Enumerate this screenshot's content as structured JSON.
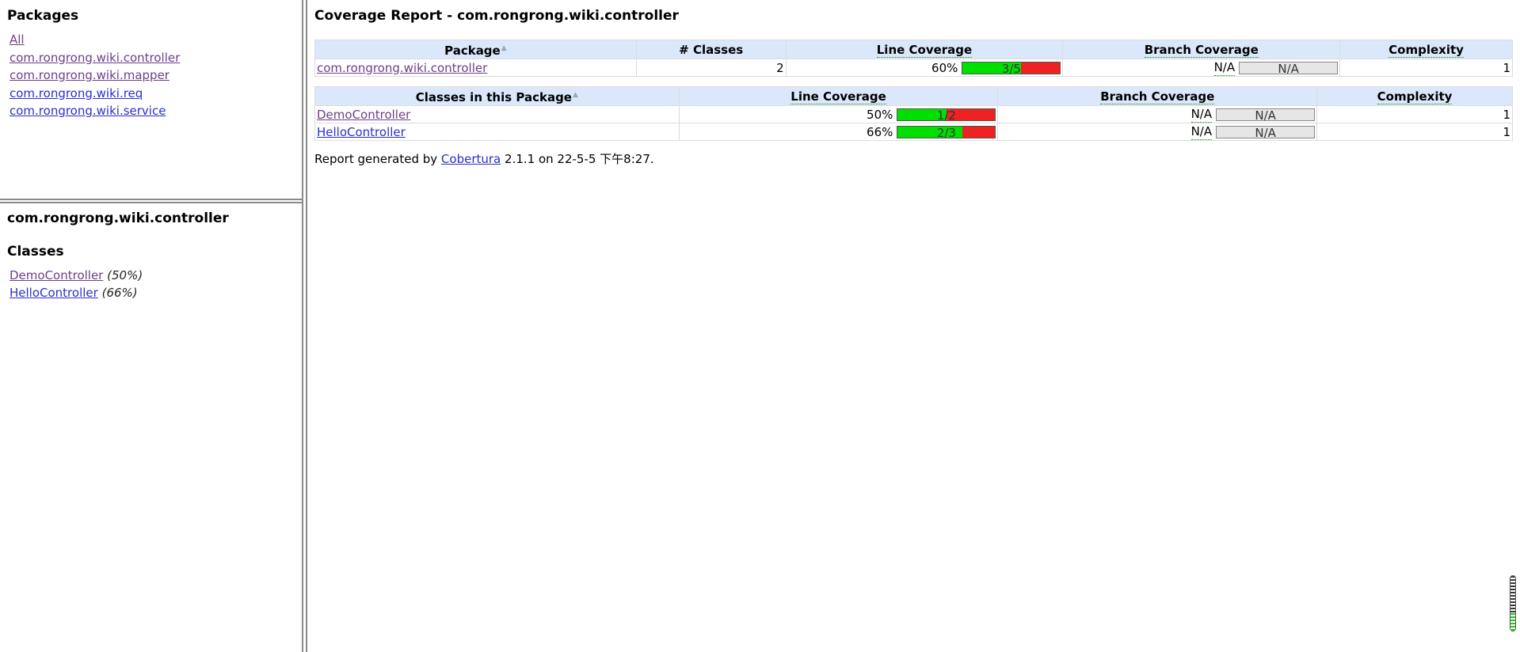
{
  "packages_frame": {
    "heading": "Packages",
    "items": [
      {
        "label": "All"
      },
      {
        "label": "com.rongrong.wiki.controller"
      },
      {
        "label": "com.rongrong.wiki.mapper"
      },
      {
        "label": "com.rongrong.wiki.req"
      },
      {
        "label": "com.rongrong.wiki.service"
      }
    ]
  },
  "classes_frame": {
    "package_name": "com.rongrong.wiki.controller",
    "heading": "Classes",
    "items": [
      {
        "name": "DemoController",
        "percent": "(50%)"
      },
      {
        "name": "HelloController",
        "percent": "(66%)"
      }
    ]
  },
  "main": {
    "title": "Coverage Report - com.rongrong.wiki.controller",
    "package_table": {
      "headers": {
        "package": "Package",
        "classes": "# Classes",
        "line": "Line Coverage",
        "branch": "Branch Coverage",
        "complexity": "Complexity"
      },
      "rows": [
        {
          "package": "com.rongrong.wiki.controller",
          "classes": "2",
          "line_percent": "60%",
          "line_bar_text": "3/5",
          "line_fraction": 0.6,
          "branch_percent": "N/A",
          "branch_bar_text": "N/A",
          "complexity": "1"
        }
      ]
    },
    "classes_table": {
      "headers": {
        "class": "Classes in this Package",
        "line": "Line Coverage",
        "branch": "Branch Coverage",
        "complexity": "Complexity"
      },
      "rows": [
        {
          "name": "DemoController",
          "line_percent": "50%",
          "line_bar_text": "1/2",
          "line_fraction": 0.5,
          "branch_percent": "N/A",
          "branch_bar_text": "N/A",
          "complexity": "1"
        },
        {
          "name": "HelloController",
          "line_percent": "66%",
          "line_bar_text": "2/3",
          "line_fraction": 0.66,
          "branch_percent": "N/A",
          "branch_bar_text": "N/A",
          "complexity": "1"
        }
      ]
    },
    "footer": {
      "prefix": "Report generated by",
      "link": "Cobertura",
      "suffix": "2.1.1 on 22-5-5 下午8:27."
    }
  },
  "colors": {
    "covered": "#00e000",
    "uncovered": "#ee2222",
    "header_bg": "#dbe7fa",
    "link": "#2a2fcf",
    "visited": "#6d3e8a"
  }
}
